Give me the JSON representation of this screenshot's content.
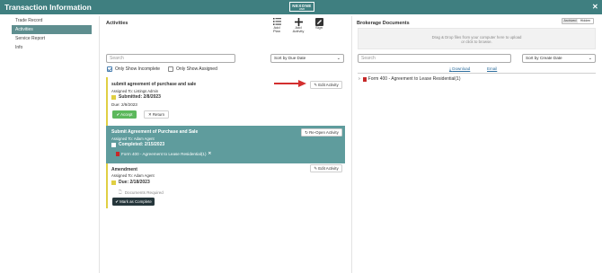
{
  "window": {
    "title": "Transaction Information",
    "logo_line1": "NEXONE",
    "logo_line2": "WEB"
  },
  "sidebar": {
    "items": [
      {
        "label": "Trade Record"
      },
      {
        "label": "Activities"
      },
      {
        "label": "Service Report"
      },
      {
        "label": "Info"
      }
    ],
    "active_index": 1
  },
  "activities": {
    "heading": "Activities",
    "toolbar": [
      {
        "label": "Add\nPlan",
        "icon": "list-icon"
      },
      {
        "label": "Add\nActivity",
        "icon": "plus-icon"
      },
      {
        "label": "Sign",
        "icon": "pen-icon"
      }
    ],
    "search_placeholder": "Search",
    "sort_value": "Sort by Due Date",
    "filters": {
      "incomplete_label": "Only Show Incomplete",
      "incomplete_checked": true,
      "assigned_label": "Only Show Assigned",
      "assigned_checked": false
    },
    "cards": [
      {
        "title": "submit agreement of purchase and sale",
        "assigned": "Assigned To:  Listings Admin",
        "status": "Submitted: 2/8/2023",
        "due": "Due: 2/9/2023",
        "edit_label": "Edit Activity",
        "accept_label": "Accept",
        "return_label": "Return"
      },
      {
        "title": "Submit Agreement of Purchase and Sale",
        "assigned": "Assigned To:  Adam Agent",
        "status": "Completed: 2/15/2023",
        "doc": "Form 400 - Agreement to Lease Residential(1)",
        "reopen_label": "Re-Open Activity"
      },
      {
        "title": "Amendment",
        "assigned": "Assigned To:  Adam Agent",
        "due": "Due: 2/18/2023",
        "documents_required": "Documents Required",
        "edit_label": "Edit Activity",
        "complete_label": "Mark as Complete"
      }
    ]
  },
  "brokerage": {
    "heading": "Brokerage Documents",
    "view_toggle": [
      "Archived",
      "Hidden"
    ],
    "drop_line1": "Drag & Drop files from your computer here to upload",
    "drop_line2": "or click to browse.",
    "search_placeholder": "Search",
    "sort_value": "Sort by Create Date",
    "download_label": "Download",
    "email_label": "Email",
    "tree_item": "Form 400 - Agreement to Lease Residential(1)"
  },
  "colors": {
    "titlebar": "#3f7f80",
    "sidebar_active": "#5e8e8f",
    "card_completed": "#5f9c9d",
    "incomplete_stripe": "#e0cf43",
    "accept_green": "#5cb85c",
    "arrow_red": "#d32f2f"
  }
}
